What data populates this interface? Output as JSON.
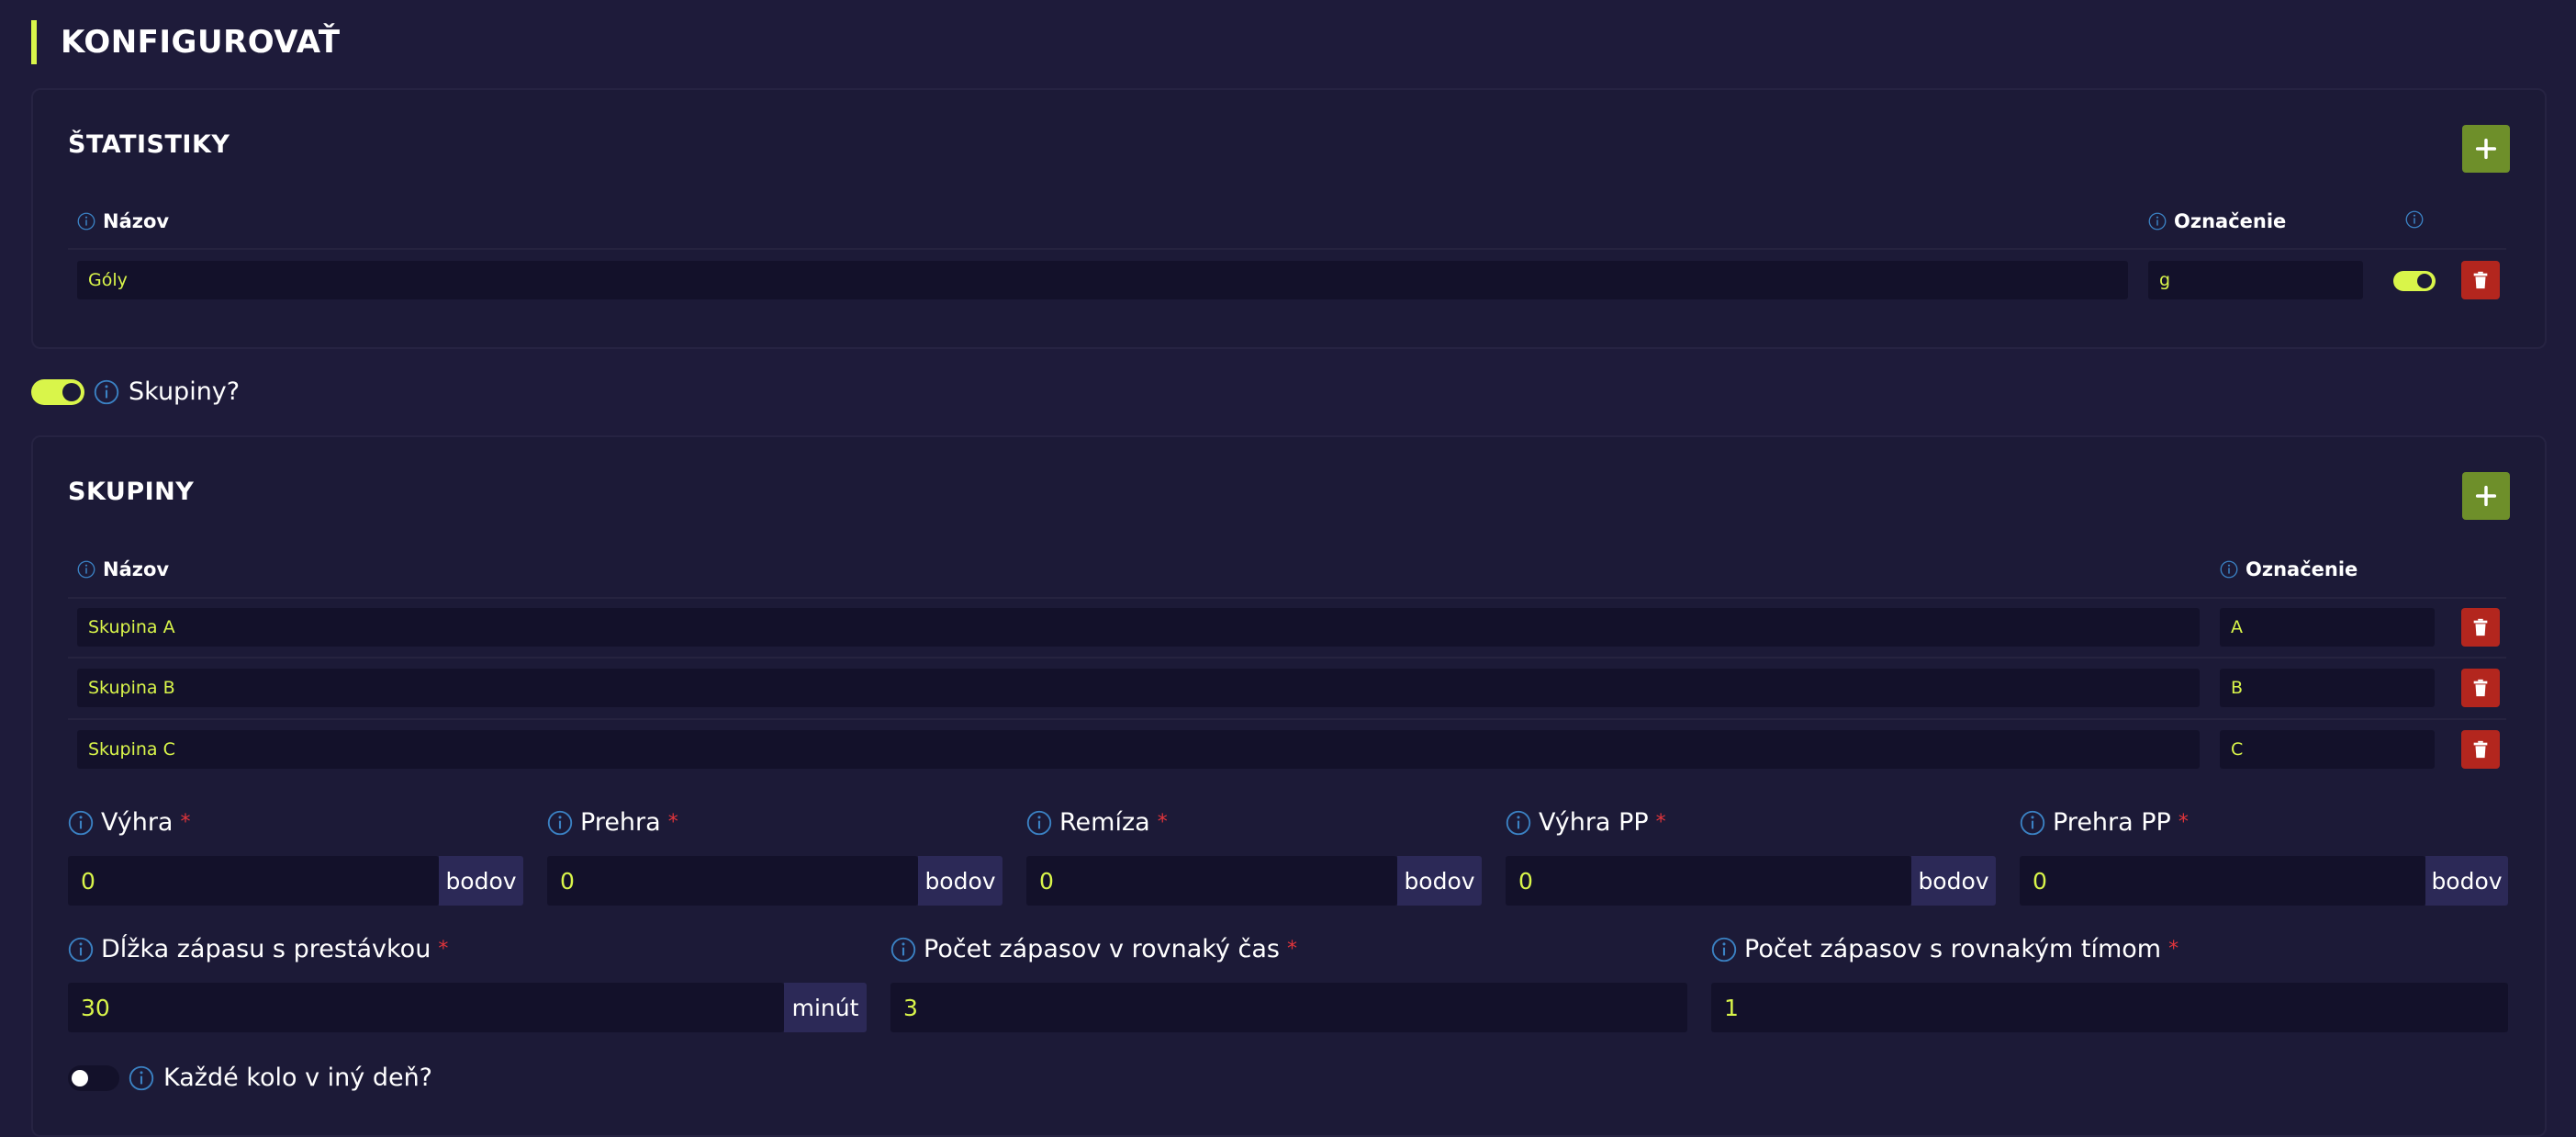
{
  "page": {
    "title": "KONFIGUROVAŤ"
  },
  "colors": {
    "accent": "#d9f54a",
    "add": "#6e8f2a",
    "delete": "#b3261e",
    "required": "#e0343b",
    "info": "#3b82c4"
  },
  "stats": {
    "title": "ŠTATISTIKY",
    "col_name": "Názov",
    "col_code": "Označenie",
    "rows": [
      {
        "name": "Góly",
        "code": "g",
        "enabled": true
      }
    ]
  },
  "groups_toggle": {
    "label": "Skupiny?",
    "enabled": true
  },
  "groups": {
    "title": "SKUPINY",
    "col_name": "Názov",
    "col_code": "Označenie",
    "rows": [
      {
        "name": "Skupina A",
        "code": "A"
      },
      {
        "name": "Skupina B",
        "code": "B"
      },
      {
        "name": "Skupina C",
        "code": "C"
      }
    ]
  },
  "points": {
    "unit": "bodov",
    "required_mark": "*",
    "fields": [
      {
        "label": "Výhra",
        "value": "0"
      },
      {
        "label": "Prehra",
        "value": "0"
      },
      {
        "label": "Remíza",
        "value": "0"
      },
      {
        "label": "Výhra PP",
        "value": "0"
      },
      {
        "label": "Prehra PP",
        "value": "0"
      }
    ]
  },
  "match": {
    "duration": {
      "label": "Dĺžka zápasu s prestávkou",
      "value": "30",
      "unit": "minút"
    },
    "parallel": {
      "label": "Počet zápasov v rovnaký čas",
      "value": "3"
    },
    "same_team": {
      "label": "Počet zápasov s rovnakým tímom",
      "value": "1"
    }
  },
  "rounds_toggle": {
    "label": "Každé kolo v iný deň?",
    "enabled": false
  }
}
